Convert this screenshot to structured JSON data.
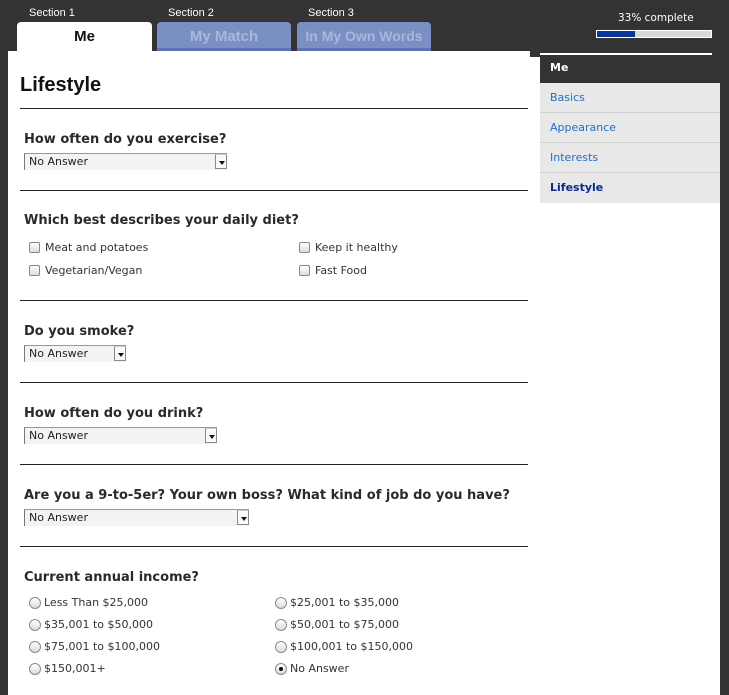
{
  "tabs": [
    {
      "section": "Section 1",
      "label": "Me",
      "active": true
    },
    {
      "section": "Section 2",
      "label": "My Match",
      "active": false
    },
    {
      "section": "Section 3",
      "label": "In My Own Words",
      "active": false
    }
  ],
  "progress": {
    "label": "33% complete",
    "percent": 33,
    "fill_color": "#0b3597"
  },
  "page": {
    "title": "Lifestyle"
  },
  "questions": {
    "exercise": {
      "title": "How often do you exercise?",
      "value": "No Answer"
    },
    "diet": {
      "title": "Which best describes your daily diet?",
      "options": [
        {
          "label": "Meat and potatoes",
          "checked": false
        },
        {
          "label": "Keep it healthy",
          "checked": false
        },
        {
          "label": "Vegetarian/Vegan",
          "checked": false
        },
        {
          "label": "Fast Food",
          "checked": false
        }
      ]
    },
    "smoke": {
      "title": "Do you smoke?",
      "value": "No Answer"
    },
    "drink": {
      "title": "How often do you drink?",
      "value": "No Answer"
    },
    "job": {
      "title": "Are you a 9-to-5er? Your own boss? What kind of job do you have?",
      "value": "No Answer"
    },
    "income": {
      "title": "Current annual income?",
      "options": [
        {
          "label": "Less Than $25,000",
          "checked": false
        },
        {
          "label": "$25,001 to $35,000",
          "checked": false
        },
        {
          "label": "$35,001 to $50,000",
          "checked": false
        },
        {
          "label": "$50,001 to $75,000",
          "checked": false
        },
        {
          "label": "$75,001 to $100,000",
          "checked": false
        },
        {
          "label": "$100,001 to $150,000",
          "checked": false
        },
        {
          "label": "$150,001+",
          "checked": false
        },
        {
          "label": "No Answer",
          "checked": true
        }
      ]
    }
  },
  "sidebar": {
    "header": "Me",
    "items": [
      {
        "label": "Basics",
        "current": false
      },
      {
        "label": "Appearance",
        "current": false
      },
      {
        "label": "Interests",
        "current": false
      },
      {
        "label": "Lifestyle",
        "current": true
      }
    ]
  }
}
